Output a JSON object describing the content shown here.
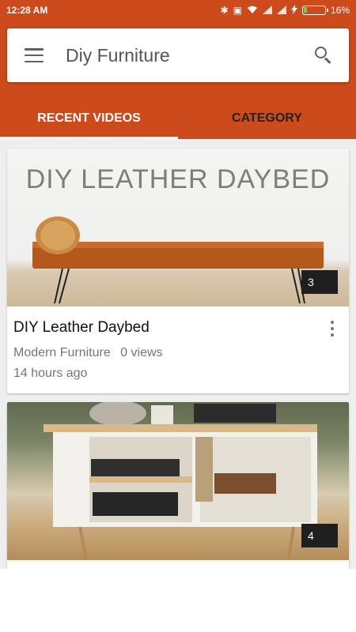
{
  "status_bar": {
    "time": "12:28 AM",
    "battery": "16%",
    "icons": [
      "bluetooth-icon",
      "vibrate-icon",
      "wifi-icon",
      "signal-icon",
      "signal-icon",
      "charging-icon",
      "battery-icon"
    ],
    "battery_level": 0.16
  },
  "header": {
    "title": "Diy Furniture",
    "menu_icon": "menu-icon",
    "search_icon": "search-icon"
  },
  "tabs": [
    {
      "label": "RECENT VIDEOS",
      "active": true
    },
    {
      "label": "CATEGORY",
      "active": false
    }
  ],
  "colors": {
    "primary": "#cc4a1b",
    "tab_active": "#ffffff",
    "tab_inactive": "#222222",
    "background": "#eeeeee"
  },
  "videos": [
    {
      "thumbnail_text": "DIY LEATHER DAYBED",
      "count": "3",
      "title": "DIY Leather Daybed",
      "category": "Modern Furniture",
      "views": "0 views",
      "time": "14 hours ago"
    },
    {
      "count": "4"
    }
  ]
}
